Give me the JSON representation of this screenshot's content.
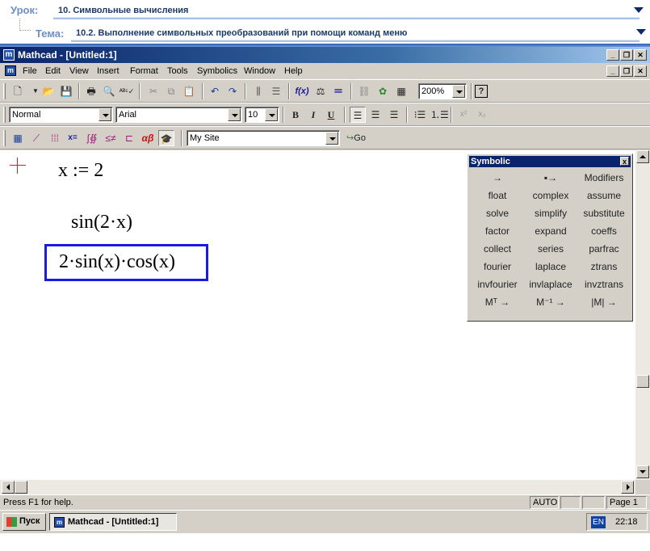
{
  "lesson": {
    "lesson_label": "Урок:",
    "lesson_value": "10. Символьные вычисления",
    "topic_label": "Тема:",
    "topic_value": "10.2. Выполнение символьных преобразований при помощи команд меню"
  },
  "window": {
    "title": "Mathcad - [Untitled:1]",
    "app_icon": "m"
  },
  "menu": {
    "items": [
      "File",
      "Edit",
      "View",
      "Insert",
      "Format",
      "Tools",
      "Symbolics",
      "Window",
      "Help"
    ]
  },
  "toolbar_standard": {
    "zoom_value": "200%",
    "help_icon": "?"
  },
  "toolbar_formatting": {
    "style_value": "Normal",
    "font_value": "Arial",
    "size_value": "10",
    "bold": "B",
    "italic": "I",
    "underline": "U",
    "superscript": "x²",
    "subscript": "x₂"
  },
  "toolbar_math": {
    "resource_value": "My Site",
    "go_label": "Go"
  },
  "worksheet": {
    "expr_define": "x :=  2",
    "expr_original": "sin(2·x)",
    "expr_selected": "2·sin(x)·cos(x)"
  },
  "palette": {
    "title": "Symbolic",
    "close": "x",
    "buttons": [
      "→",
      "▪→",
      "Modifiers",
      "float",
      "complex",
      "assume",
      "solve",
      "simplify",
      "substitute",
      "factor",
      "expand",
      "coeffs",
      "collect",
      "series",
      "parfrac",
      "fourier",
      "laplace",
      "ztrans",
      "invfourier",
      "invlaplace",
      "invztrans",
      "Mᵀ →",
      "M⁻¹ →",
      "|M| →"
    ]
  },
  "status": {
    "help_text": "Press F1 for help.",
    "mode": "AUTO",
    "page": "Page 1"
  },
  "taskbar": {
    "start_label": "Пуск",
    "task_label": "Mathcad - [Untitled:1]",
    "lang": "EN",
    "clock": "22:18"
  },
  "colors": {
    "titlebar": "#0a246a",
    "selection_box": "#1a1ae6",
    "lesson_label": "#6e8fc7"
  }
}
